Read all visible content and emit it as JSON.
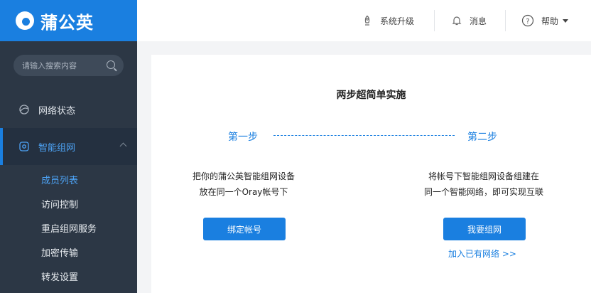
{
  "app": {
    "logo_text": "蒲公英"
  },
  "sidebar": {
    "search": {
      "placeholder": "请输入搜索内容"
    },
    "nav": [
      {
        "label": "网络状态",
        "icon": "network-status-icon"
      },
      {
        "label": "智能组网",
        "icon": "smart-network-icon"
      }
    ],
    "submenu": [
      {
        "label": "成员列表",
        "active": true
      },
      {
        "label": "访问控制"
      },
      {
        "label": "重启组网服务"
      },
      {
        "label": "加密传输"
      },
      {
        "label": "转发设置"
      }
    ]
  },
  "header": {
    "upgrade_label": "系统升级",
    "messages_label": "消息",
    "help_label": "帮助"
  },
  "main": {
    "title": "两步超简单实施",
    "step1": {
      "label": "第一步",
      "desc_line1": "把你的蒲公英智能组网设备",
      "desc_line2": "放在同一个Oray帐号下",
      "button": "绑定帐号"
    },
    "step2": {
      "label": "第二步",
      "desc_line1": "将帐号下智能组网设备组建在",
      "desc_line2": "同一个智能网络，即可实现互联",
      "button": "我要组网",
      "link": "加入已有网络 >>"
    }
  },
  "colors": {
    "accent": "#1a7fe0",
    "sidebar_bg": "#2c3745",
    "active_text": "#4da3f5"
  }
}
